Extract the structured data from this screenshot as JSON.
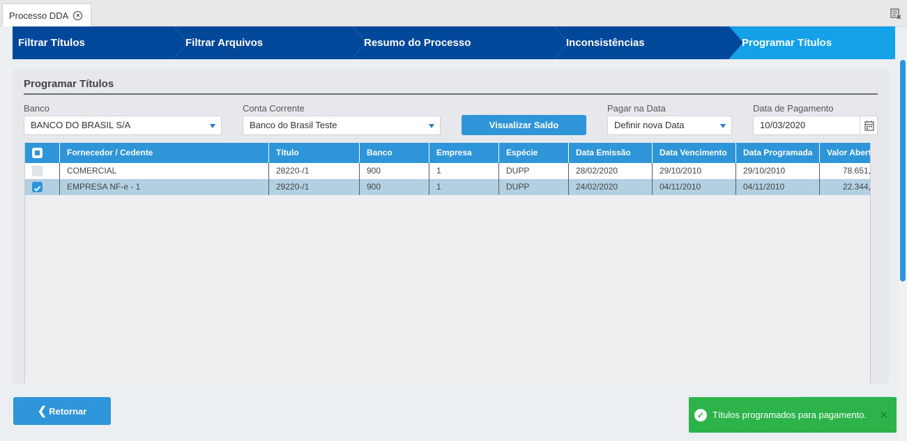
{
  "tab": {
    "title": "Processo DDA"
  },
  "steps": [
    {
      "label": "Filtrar Títulos"
    },
    {
      "label": "Filtrar Arquivos"
    },
    {
      "label": "Resumo do Processo"
    },
    {
      "label": "Inconsistências"
    },
    {
      "label": "Programar Títulos"
    }
  ],
  "panel": {
    "title": "Programar Títulos",
    "banco": {
      "label": "Banco",
      "value": "BANCO DO BRASIL S/A"
    },
    "conta": {
      "label": "Conta Corrente",
      "value": "Banco do Brasil Teste"
    },
    "visualizar_saldo": "Visualizar Saldo",
    "pagar": {
      "label": "Pagar na Data",
      "value": "Definir nova Data"
    },
    "data_pagamento": {
      "label": "Data de Pagamento",
      "value": "10/03/2020"
    }
  },
  "grid": {
    "columns": [
      "Fornecedor / Cedente",
      "Título",
      "Banco",
      "Empresa",
      "Espécie",
      "Data Emissão",
      "Data Vencimento",
      "Data Programada",
      "Valor Abert"
    ],
    "rows": [
      {
        "checked": false,
        "fornecedor": "COMERCIAL",
        "titulo": "28220-/1",
        "banco": "900",
        "empresa": "1",
        "especie": "DUPP",
        "emissao": "28/02/2020",
        "vencimento": "29/10/2010",
        "programada": "29/10/2010",
        "valor": "78.651,"
      },
      {
        "checked": true,
        "fornecedor": "EMPRESA NF-e - 1",
        "titulo": "29220-/1",
        "banco": "900",
        "empresa": "1",
        "especie": "DUPP",
        "emissao": "24/02/2020",
        "vencimento": "04/11/2010",
        "programada": "04/11/2010",
        "valor": "22.344,"
      }
    ]
  },
  "footer": {
    "back_label": "Retornar"
  },
  "toast": {
    "message": "Títulos programados para pagamento."
  },
  "colors": {
    "primary": "#2e95d9",
    "nav": "#02489a",
    "nav_active": "#14a1e8",
    "success": "#2cb44a"
  }
}
